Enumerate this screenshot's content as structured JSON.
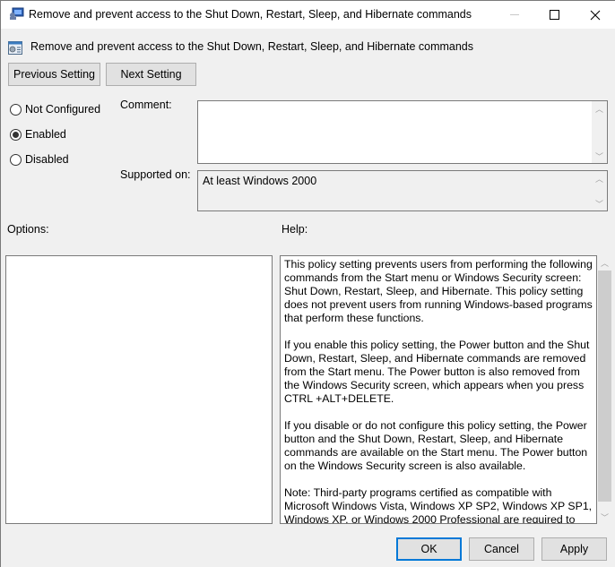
{
  "window": {
    "title": "Remove and prevent access to the Shut Down, Restart, Sleep, and Hibernate commands",
    "controls": {
      "minimize": "—",
      "maximize": "☐",
      "close": "✕"
    }
  },
  "header": {
    "title": "Remove and prevent access to the Shut Down, Restart, Sleep, and Hibernate commands"
  },
  "nav": {
    "previous_label": "Previous Setting",
    "next_label": "Next Setting"
  },
  "state": {
    "options": [
      {
        "label": "Not Configured",
        "checked": false
      },
      {
        "label": "Enabled",
        "checked": true
      },
      {
        "label": "Disabled",
        "checked": false
      }
    ]
  },
  "comment": {
    "label": "Comment:",
    "value": ""
  },
  "supported": {
    "label": "Supported on:",
    "value": "At least Windows 2000"
  },
  "options_section": {
    "label": "Options:"
  },
  "help_section": {
    "label": "Help:",
    "paragraphs": [
      "This policy setting prevents users from performing the following commands from the Start menu or Windows Security screen: Shut Down, Restart, Sleep, and Hibernate. This policy setting does not prevent users from running Windows-based programs that perform these functions.",
      "If you enable this policy setting, the Power button and the Shut Down, Restart, Sleep, and Hibernate commands are removed from the Start menu. The Power button is also removed from the Windows Security screen, which appears when you press CTRL +ALT+DELETE.",
      "If you disable or do not configure this policy setting, the Power button and the Shut Down, Restart, Sleep, and Hibernate commands are available on the Start menu. The Power button on the Windows Security screen is also available.",
      "Note: Third-party programs certified as compatible with Microsoft Windows Vista, Windows XP SP2, Windows XP SP1, Windows XP, or Windows 2000 Professional are required to"
    ]
  },
  "footer": {
    "ok_label": "OK",
    "cancel_label": "Cancel",
    "apply_label": "Apply"
  },
  "scroll_glyphs": {
    "up": "︿",
    "down": "﹀"
  },
  "colors": {
    "accent": "#0078d7",
    "background": "#f0f0f0",
    "button": "#e1e1e1"
  }
}
